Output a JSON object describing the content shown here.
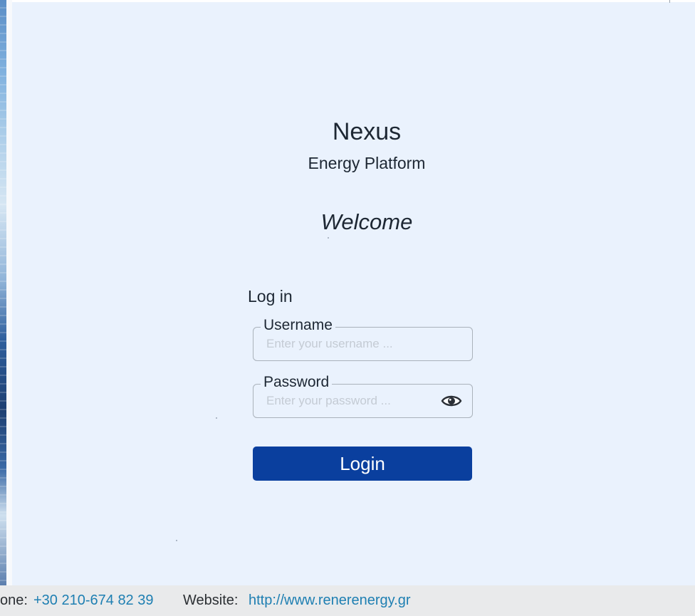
{
  "brand": {
    "title": "Nexus",
    "subtitle": "Energy Platform",
    "welcome": "Welcome"
  },
  "login_form": {
    "heading": "Log in",
    "username": {
      "label": "Username",
      "placeholder": "Enter your username ...",
      "value": ""
    },
    "password": {
      "label": "Password",
      "placeholder": "Enter your password ...",
      "value": "",
      "toggle_icon": "eye-icon"
    },
    "submit_label": "Login"
  },
  "footer": {
    "phone_label": "one:",
    "phone_value": "+30 210-674 82 39",
    "website_label": "Website:",
    "website_value": "http://www.renerenergy.gr"
  },
  "colors": {
    "panel_background": "#eaf2fd",
    "primary_button": "#0a3f9e",
    "link": "#1e7fb2",
    "footer_background": "#e9eaeb"
  }
}
